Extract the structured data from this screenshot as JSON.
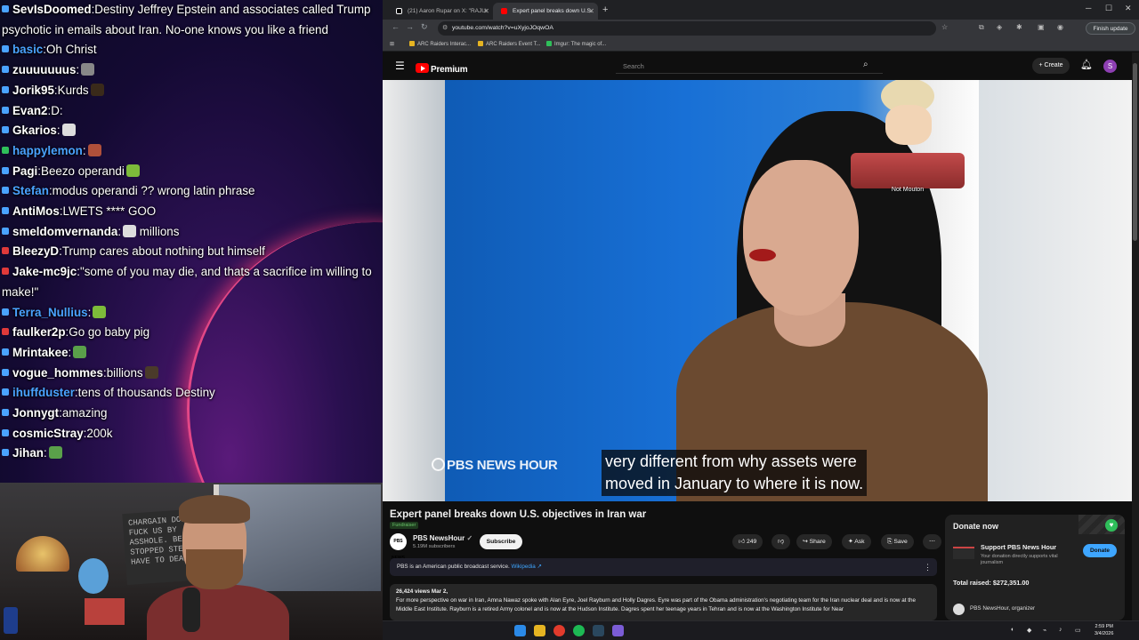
{
  "chat": {
    "messages": [
      {
        "user": "SevIsDoomed",
        "text": "Destiny Jeffrey Epstein and associates called Trump psychotic in emails about Iran. No-one knows you like a friend",
        "color": "#ffffff",
        "badge": "#4aa3ff"
      },
      {
        "user": "basic",
        "text": "Oh Christ",
        "color": "#4aa3ff",
        "badge": "#4aa3ff"
      },
      {
        "user": "zuuuuuuus",
        "text": "",
        "color": "#ffffff",
        "badge": "#4aa3ff",
        "emote": "#888888"
      },
      {
        "user": "Jorik95",
        "text": "Kurds",
        "color": "#ffffff",
        "badge": "#4aa3ff",
        "emote": "#3a2a1a"
      },
      {
        "user": "Evan2",
        "text": "D:",
        "color": "#ffffff",
        "badge": "#4aa3ff"
      },
      {
        "user": "Gkarios",
        "text": "",
        "color": "#ffffff",
        "badge": "#4aa3ff",
        "emote": "#dddddd"
      },
      {
        "user": "happylemon",
        "text": "",
        "color": "#4aa3ff",
        "badge": "#2fbf5a",
        "emote": "#b0503a"
      },
      {
        "user": "Pagi",
        "text": "Beezo operandi",
        "color": "#ffffff",
        "badge": "#4aa3ff",
        "emote": "#7dbb3a"
      },
      {
        "user": "Stefan",
        "text": "modus operandi ?? wrong latin phrase",
        "color": "#4aa3ff",
        "badge": "#4aa3ff"
      },
      {
        "user": "AntiMos",
        "text": "LWETS **** GOO",
        "color": "#ffffff",
        "badge": "#4aa3ff"
      },
      {
        "user": "smeldomvernanda",
        "text": " millions",
        "color": "#ffffff",
        "badge": "#4aa3ff",
        "emote": "#dddddd"
      },
      {
        "user": "BleezyD",
        "text": "Trump cares about nothing but himself",
        "color": "#ffffff",
        "badge": "#e03a3a"
      },
      {
        "user": "Jake-mc9jc",
        "text": "\"some of you may die, and thats a sacrifice im willing to make!\"",
        "color": "#ffffff",
        "badge": "#e03a3a"
      },
      {
        "user": "Terra_Nullius",
        "text": "",
        "color": "#4aa3ff",
        "badge": "#4aa3ff",
        "emote": "#7dbb3a"
      },
      {
        "user": "faulker2p",
        "text": "Go go baby pig",
        "color": "#ffffff",
        "badge": "#e03a3a"
      },
      {
        "user": "Mrintakee",
        "text": "",
        "color": "#ffffff",
        "badge": "#4aa3ff",
        "emote": "#5aa04a"
      },
      {
        "user": "vogue_hommes",
        "text": "billions",
        "color": "#ffffff",
        "badge": "#4aa3ff",
        "emote": "#4a3a2a"
      },
      {
        "user": "ihuffduster",
        "text": "tens of thousands Destiny",
        "color": "#4aa3ff",
        "badge": "#4aa3ff"
      },
      {
        "user": "Jonnygt",
        "text": "amazing",
        "color": "#ffffff",
        "badge": "#4aa3ff"
      },
      {
        "user": "cosmicStray",
        "text": "200k",
        "color": "#ffffff",
        "badge": "#4aa3ff"
      },
      {
        "user": "Jihan",
        "text": "",
        "color": "#ffffff",
        "badge": "#4aa3ff",
        "emote": "#5aa04a"
      }
    ]
  },
  "webcam": {
    "board_text": "CHARGAIN DONAT\nFUCK US BY\nASSHOLE. BEC\nSTOPPED STEA\nHAVE TO DEAL"
  },
  "browser": {
    "tabs": [
      {
        "title": "(21) Aaron Rupar on X: \"RAJU:",
        "icon_color": "#ffffff"
      },
      {
        "title": "Expert panel breaks down U.S.",
        "icon_color": "#ff0000"
      }
    ],
    "url": "youtube.com/watch?v=uXyjoJOqwOA",
    "finish_update": "Finish update",
    "bookmarks": [
      "ARC Raiders Interac...",
      "ARC Raiders Event T...",
      "Imgur: The magic of..."
    ]
  },
  "youtube": {
    "logo_text": "Premium",
    "search_placeholder": "Search",
    "create_label": "Create",
    "avatar_letter": "S",
    "overlay_label": "Not Mouton",
    "video_brand": "PBS NEWS HOUR",
    "caption_line1": "very different from why assets were",
    "caption_line2": "moved in January to where it is now.",
    "title": "Expert panel breaks down U.S. objectives in Iran war",
    "fundraiser": "Fundraiser",
    "channel": {
      "name": "PBS NewsHour",
      "subs": "5.19M subscribers",
      "avatar_text": "PBS NEWS"
    },
    "subscribe_label": "Subscribe",
    "likes": "249",
    "share_label": "Share",
    "ask_label": "Ask",
    "save_label": "Save",
    "info_text": "PBS is an American public broadcast service.",
    "info_link": "Wikipedia",
    "desc_meta": "26,424 views  Mar 2,",
    "desc_text": "For more perspective on war in Iran, Amna Nawaz spoke with Alan Eyre, Joel Rayburn and Holly Dagres. Eyre was part of the Obama administration's negotiating team for the Iran nuclear deal and is now at the Middle East Institute. Rayburn is a retired Army colonel and is now at the Hudson Institute. Dagres spent her teenage years in Tehran and is now at the Washington Institute for Near"
  },
  "donate": {
    "heading": "Donate now",
    "org": "Support PBS News Hour",
    "sub": "Your donation directly supports vital journalism",
    "button": "Donate",
    "raised": "Total raised: $272,351.00",
    "organizer": "PBS NewsHour, organizer"
  },
  "taskbar": {
    "time": "2:59 PM",
    "date": "3/4/2026"
  }
}
